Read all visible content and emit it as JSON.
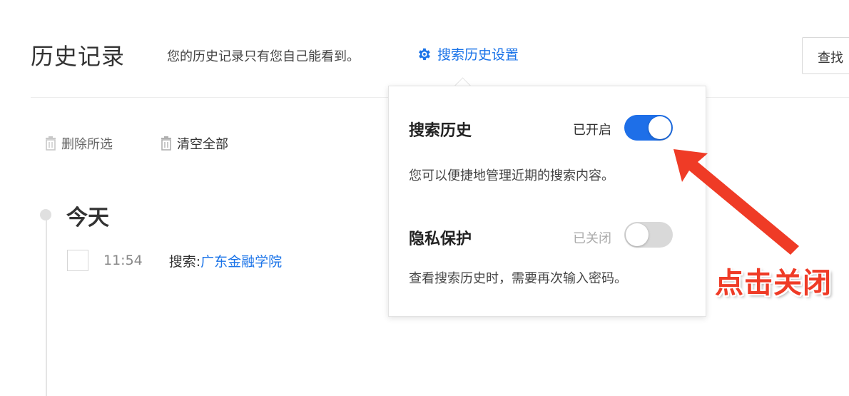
{
  "header": {
    "title": "历史记录",
    "note": "您的历史记录只有您自己能看到。",
    "settings_link": "搜索历史设置",
    "find_button": "查找"
  },
  "toolbar": {
    "delete_selected": "删除所选",
    "clear_all": "清空全部"
  },
  "timeline": {
    "day": "今天",
    "items": [
      {
        "time": "11:54",
        "prefix": "搜索:",
        "query": "广东金融学院"
      }
    ]
  },
  "popup": {
    "search_history": {
      "title": "搜索历史",
      "status": "已开启",
      "enabled": true,
      "description": "您可以便捷地管理近期的搜索内容。"
    },
    "privacy": {
      "title": "隐私保护",
      "status": "已关闭",
      "enabled": false,
      "description": "查看搜索历史时，需要再次输入密码。"
    }
  },
  "annotation": {
    "label": "点击关闭"
  },
  "colors": {
    "accent": "#1e6fe8",
    "link": "#1a73e8",
    "annotation": "#ef3b26",
    "toggle_off": "#d9d9d9"
  },
  "icons": {
    "settings": "gear-icon",
    "delete_selected": "trash-icon",
    "clear_all": "trash-icon"
  }
}
